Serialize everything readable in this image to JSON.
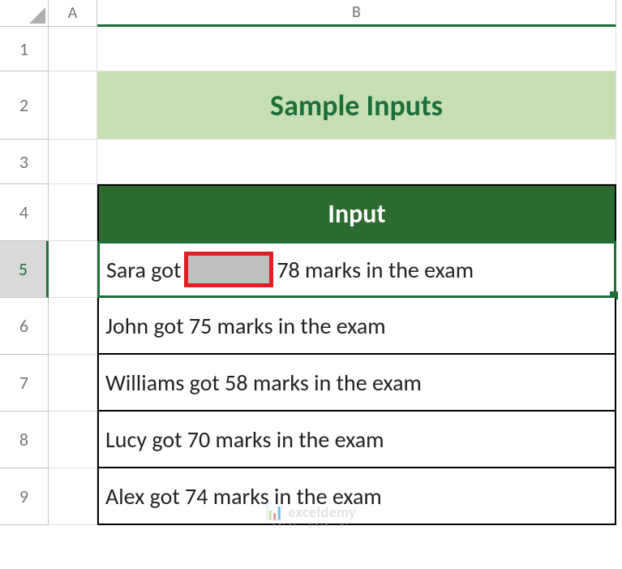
{
  "columns": {
    "A": "A",
    "B": "B"
  },
  "rows": [
    "1",
    "2",
    "3",
    "4",
    "5",
    "6",
    "7",
    "8",
    "9"
  ],
  "title": "Sample Inputs",
  "table_header": "Input",
  "selected_row_parts": {
    "left": "Sara got",
    "right": "78 marks in the exam"
  },
  "data_rows": [
    "John got 75 marks in the exam",
    "Williams got 58 marks in the exam",
    "Lucy got 70 marks in the exam",
    "Alex got 74 marks in the exam"
  ],
  "watermark": {
    "main": "exceldemy",
    "sub": "EXCEL · DATA · BI"
  },
  "chart_data": {
    "type": "table",
    "title": "Sample Inputs",
    "columns": [
      "Input"
    ],
    "rows": [
      [
        "Sara got [  ] 78 marks in the exam"
      ],
      [
        "John got 75 marks in the exam"
      ],
      [
        "Williams got 58 marks in the exam"
      ],
      [
        "Lucy got 70 marks in the exam"
      ],
      [
        "Alex got 74 marks in the exam"
      ]
    ]
  }
}
